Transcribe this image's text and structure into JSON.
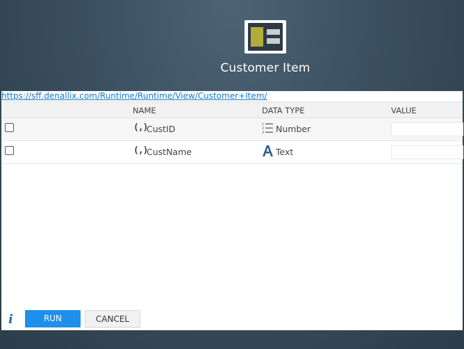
{
  "dialog": {
    "title": "Customer Item",
    "url": "https://sff.denallix.com/Runtime/Runtime/View/Customer+Item/"
  },
  "table": {
    "columns": [
      "NAME",
      "DATA TYPE",
      "VALUE"
    ],
    "rows": [
      {
        "name_icon": "(,)",
        "name": "CustID",
        "type_icon": "number-list-icon",
        "type": "Number",
        "value": ""
      },
      {
        "name_icon": "(,)",
        "name": "CustName",
        "type_icon": "text-a-icon",
        "type": "Text",
        "value": ""
      }
    ]
  },
  "footer": {
    "info_glyph": "i",
    "run_label": "RUN",
    "cancel_label": "CANCEL"
  },
  "colors": {
    "accent": "#1e8fea",
    "link": "#1478c8",
    "logo_gold": "#b3ac3a",
    "header_bg": "#3a4f5f"
  }
}
